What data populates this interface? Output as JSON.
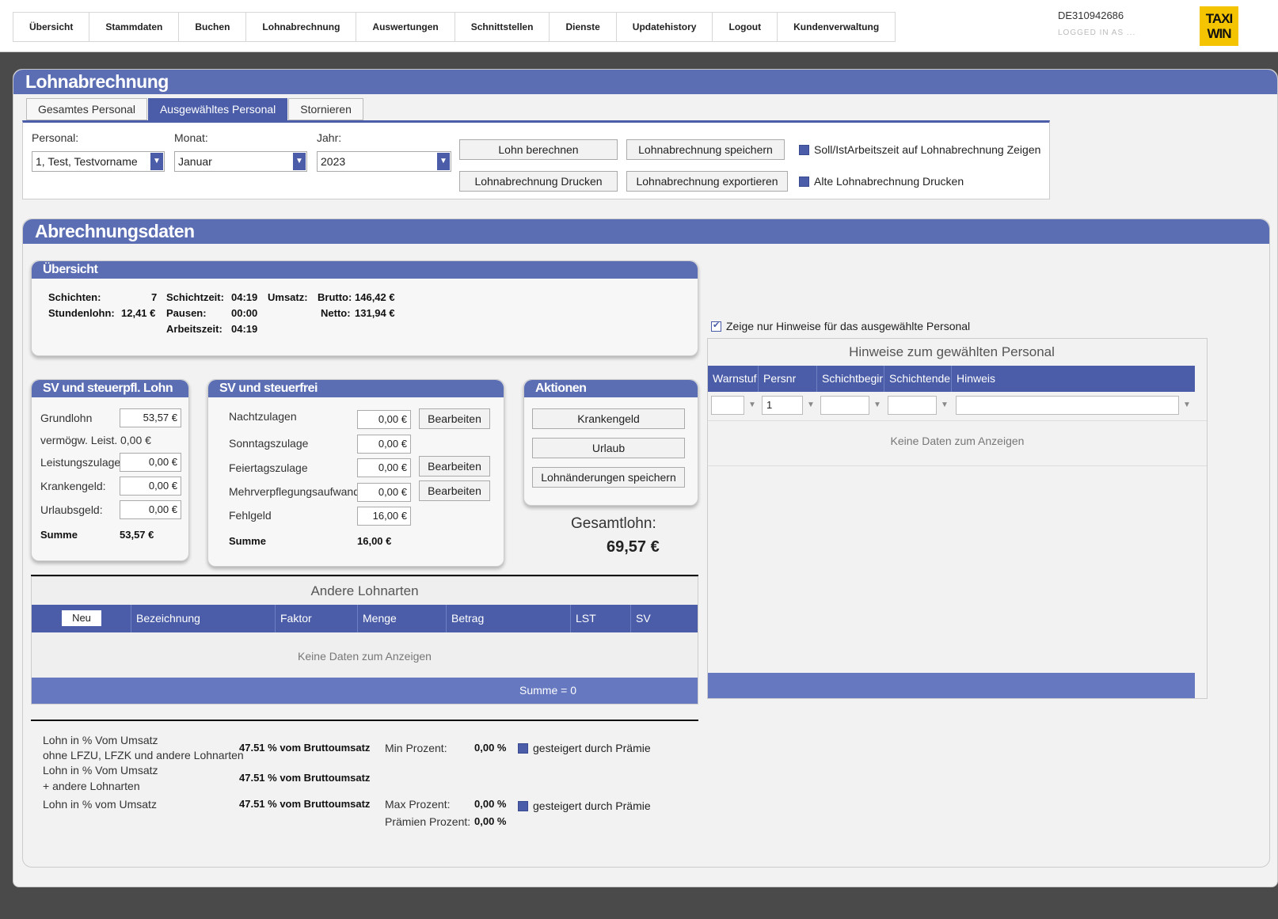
{
  "nav": [
    "Übersicht",
    "Stammdaten",
    "Buchen",
    "Lohnabrechnung",
    "Auswertungen",
    "Schnittstellen",
    "Dienste",
    "Updatehistory",
    "Logout",
    "Kundenverwaltung"
  ],
  "user": {
    "id": "DE310942686",
    "logged_in": "LOGGED IN AS ..."
  },
  "logo": {
    "line1": "TAXI",
    "line2": "WIN"
  },
  "page_title": "Lohnabrechnung",
  "tabs": [
    "Gesamtes Personal",
    "Ausgewähltes Personal",
    "Stornieren"
  ],
  "filters": {
    "personal_label": "Personal:",
    "personal_value": "1, Test, Testvorname",
    "monat_label": "Monat:",
    "monat_value": "Januar",
    "jahr_label": "Jahr:",
    "jahr_value": "2023"
  },
  "buttons": {
    "lohn_berechnen": "Lohn berechnen",
    "lohn_speichern": "Lohnabrechnung speichern",
    "lohn_drucken": "Lohnabrechnung Drucken",
    "lohn_exportieren": "Lohnabrechnung exportieren"
  },
  "checks": {
    "soll_ist": "Soll/IstArbeitszeit auf Lohnabrechnung Zeigen",
    "alte": "Alte Lohnabrechnung Drucken"
  },
  "abr_title": "Abrechnungsdaten",
  "overview": {
    "title": "Übersicht",
    "schichten_label": "Schichten:",
    "schichten": "7",
    "stundenlohn_label": "Stundenlohn:",
    "stundenlohn": "12,41 €",
    "schichtzeit_label": "Schichtzeit:",
    "schichtzeit": "04:19",
    "pausen_label": "Pausen:",
    "pausen": "00:00",
    "arbeitszeit_label": "Arbeitszeit:",
    "arbeitszeit": "04:19",
    "umsatz_label": "Umsatz:",
    "brutto_label": "Brutto:",
    "brutto": "146,42 €",
    "netto_label": "Netto:",
    "netto": "131,94 €"
  },
  "sv_lohn": {
    "title": "SV und steuerpfl. Lohn",
    "grundlohn_label": "Grundlohn",
    "grundlohn": "53,57 €",
    "vermoegen_label": "vermögw. Leist.",
    "vermoegen": "0,00 €",
    "leistung_label": "Leistungszulage",
    "leistung": "0,00 €",
    "kranken_label": "Krankengeld:",
    "kranken": "0,00 €",
    "urlaub_label": "Urlaubsgeld:",
    "urlaub": "0,00 €",
    "summe_label": "Summe",
    "summe": "53,57 €"
  },
  "sv_frei": {
    "title": "SV und steuerfrei",
    "nacht_label": "Nachtzulagen",
    "nacht": "0,00 €",
    "sonntag_label": "Sonntagszulage",
    "sonntag": "0,00 €",
    "feiertag_label": "Feiertagszulage",
    "feiertag": "0,00 €",
    "mehr_label": "Mehrverpflegungsaufwand",
    "mehr": "0,00 €",
    "fehl_label": "Fehlgeld",
    "fehl": "16,00 €",
    "summe_label": "Summe",
    "summe": "16,00 €",
    "bearbeiten": "Bearbeiten"
  },
  "aktionen": {
    "title": "Aktionen",
    "krankengeld": "Krankengeld",
    "urlaub": "Urlaub",
    "speichern": "Lohnänderungen speichern"
  },
  "gesamt": {
    "label": "Gesamtlohn:",
    "value": "69,57 €"
  },
  "andere": {
    "title": "Andere Lohnarten",
    "neu": "Neu",
    "columns": [
      "Bezeichnung",
      "Faktor",
      "Menge",
      "Betrag",
      "LST",
      "SV"
    ],
    "empty": "Keine Daten zum Anzeigen",
    "summe": "Summe = 0"
  },
  "hinweise": {
    "check_label": "Zeige nur Hinweise für das ausgewählte Personal",
    "title": "Hinweise zum gewählten Personal",
    "columns": [
      "Warnstuf",
      "Persnr",
      "Schichtbegir",
      "Schichtende",
      "Hinweis"
    ],
    "persnr_filter": "1",
    "empty": "Keine Daten zum Anzeigen"
  },
  "percent": {
    "row1_label1": "Lohn in % Vom Umsatz",
    "row1_label2": "ohne LFZU, LFZK und andere Lohnarten",
    "row1_value": "47.51 % vom Bruttoumsatz",
    "row2_label1": "Lohn in % Vom Umsatz",
    "row2_label2": "+ andere Lohnarten",
    "row2_value": "47.51 % vom Bruttoumsatz",
    "row3_label": "Lohn in % vom Umsatz",
    "row3_value": "47.51 % vom Bruttoumsatz",
    "min_label": "Min Prozent:",
    "min_value": "0,00 %",
    "max_label": "Max Prozent:",
    "max_value": "0,00 %",
    "praemie_label": "Prämien Prozent:",
    "praemie_value": "0,00 %",
    "gesteigert": "gesteigert durch Prämie"
  }
}
